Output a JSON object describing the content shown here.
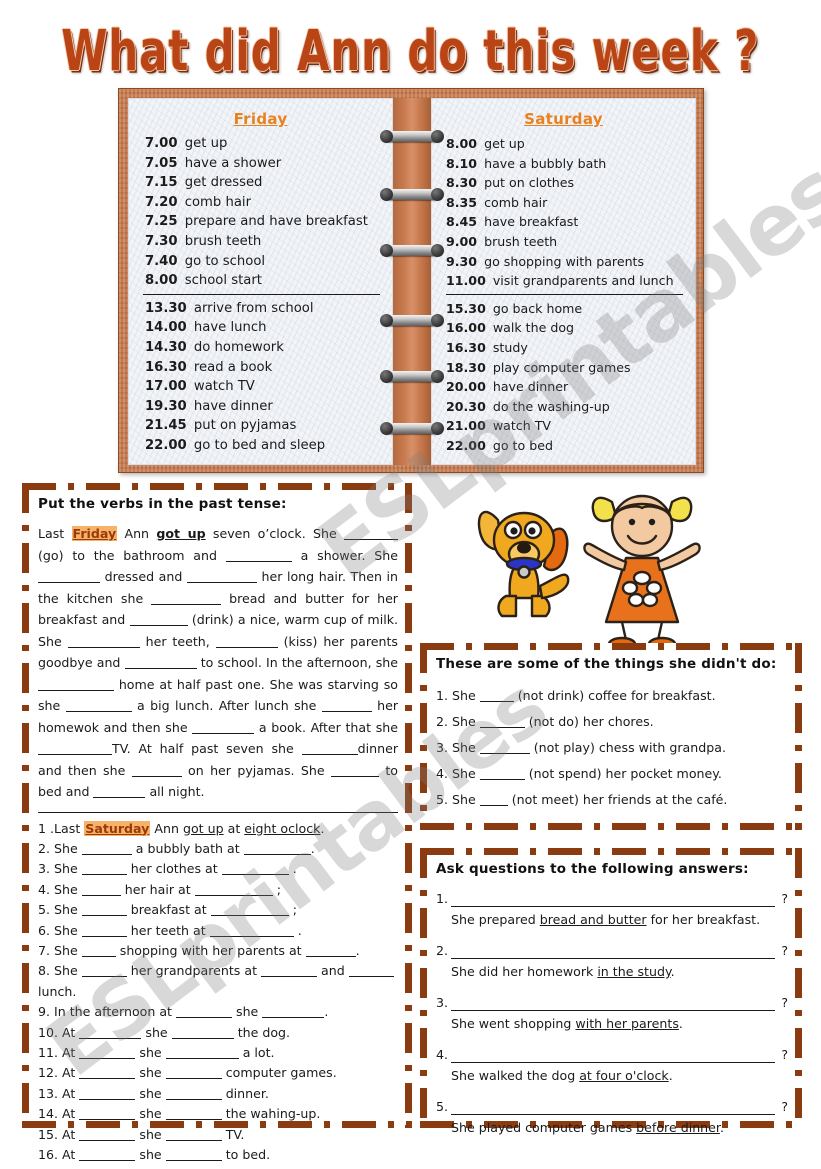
{
  "title": "What did Ann do this week ?",
  "notebook": {
    "friday": {
      "heading": "Friday",
      "morning": [
        {
          "time": "7.00",
          "activity": "get up"
        },
        {
          "time": "7.05",
          "activity": "have a shower"
        },
        {
          "time": "7.15",
          "activity": "get dressed"
        },
        {
          "time": "7.20",
          "activity": "comb hair"
        },
        {
          "time": "7.25",
          "activity": "prepare and have breakfast"
        },
        {
          "time": "7.30",
          "activity": "brush teeth"
        },
        {
          "time": "7.40",
          "activity": "go to school"
        },
        {
          "time": "8.00",
          "activity": "school start"
        }
      ],
      "afternoon": [
        {
          "time": "13.30",
          "activity": "arrive from school"
        },
        {
          "time": "14.00",
          "activity": "have lunch"
        },
        {
          "time": "14.30",
          "activity": "do homework"
        },
        {
          "time": "16.30",
          "activity": "read a book"
        },
        {
          "time": "17.00",
          "activity": "watch TV"
        },
        {
          "time": "19.30",
          "activity": "have dinner"
        },
        {
          "time": "21.45",
          "activity": "put on pyjamas"
        },
        {
          "time": "22.00",
          "activity": "go to bed and sleep"
        }
      ]
    },
    "saturday": {
      "heading": "Saturday",
      "morning": [
        {
          "time": "8.00",
          "activity": "get up"
        },
        {
          "time": "8.10",
          "activity": "have a bubbly bath"
        },
        {
          "time": "8.30",
          "activity": "put on clothes"
        },
        {
          "time": "8.35",
          "activity": "comb hair"
        },
        {
          "time": "8.45",
          "activity": "have breakfast"
        },
        {
          "time": "9.00",
          "activity": "brush teeth"
        },
        {
          "time": "9.30",
          "activity": "go shopping with parents"
        },
        {
          "time": "11.00",
          "activity": "visit grandparents and lunch"
        }
      ],
      "afternoon": [
        {
          "time": "15.30",
          "activity": "go back home"
        },
        {
          "time": "16.00",
          "activity": "walk the dog"
        },
        {
          "time": "16.30",
          "activity": "study"
        },
        {
          "time": "18.30",
          "activity": "play computer games"
        },
        {
          "time": "20.00",
          "activity": "have dinner"
        },
        {
          "time": "20.30",
          "activity": "do the washing-up"
        },
        {
          "time": "21.00",
          "activity": "watch TV"
        },
        {
          "time": "22.00",
          "activity": "go to bed"
        }
      ]
    }
  },
  "exercise1": {
    "heading": "Put the verbs in the past tense:",
    "paragraph_plain": "Last Friday Ann got up seven o'clock. She ______ (go) to the bathroom and ________ a shower. She _______ dressed and _________ her long hair. Then in the kitchen she _________ bread and butter for her breakfast and _______ (drink) a nice, warm cup of milk. She _________ her teeth, ________ (kiss) her parents goodbye and __________ to school. In the afternoon, she __________ home at half past one. She was starving so she ________ a big lunch. After lunch she ______ her homewok and then she ________ a book. After that she __________ TV. At half past seven she ________ dinner and then she ______ on her pyjamas. She ______ to bed and ______ all night.",
    "highlight_word": "Friday",
    "bold_underline": "got up",
    "hints": [
      "(go)",
      "(drink)",
      "(kiss)"
    ]
  },
  "exercise2": {
    "items": [
      "1 .Last Saturday Ann got up at eight oclock.",
      "2. She _________ a bubbly bath at ____________.",
      "3. She ________ her clothes at ____________ .",
      "4. She _______ her hair at ______________ ;",
      "5. She ________ breakfast at ______________ ;",
      "6. She ________ her teeth at _______________ .",
      "7. She ______ shopping with her parents at _________.",
      "8. She ________ her grandparents at __________ and ________ lunch.",
      "9. In the afternoon at __________ she ___________.",
      "10. At ___________ she ___________ the dog.",
      "11. At __________ she _____________ a lot.",
      "12. At __________ she __________ computer games.",
      "13. At __________ she __________ dinner.",
      "14. At __________ she __________ the wahing-up.",
      "15. At __________ she __________ TV.",
      "16. At __________ she __________ to bed."
    ],
    "highlight_word": "Saturday",
    "underlined": [
      "got up",
      "eight oclock"
    ]
  },
  "exercise3": {
    "heading": "These are some of the things she didn't do:",
    "items": [
      "1. She ______ (not  drink) coffee for breakfast.",
      "2. She ________ (not do) her chores.",
      "3. She _________ (not play) chess with grandpa.",
      "4. She ________ (not spend) her pocket money.",
      "5. She _____ (not meet) her friends at the café."
    ]
  },
  "exercise4": {
    "heading": "Ask questions to the following answers:",
    "question_mark": "?",
    "items": [
      {
        "num": "1.",
        "answer_pre": "She prepared ",
        "answer_key": "bread and butter",
        "answer_post": " for her breakfast."
      },
      {
        "num": "2.",
        "answer_pre": " She did her homework ",
        "answer_key": "in the study",
        "answer_post": "."
      },
      {
        "num": "3.",
        "answer_pre": "She went shopping ",
        "answer_key": "with her parents",
        "answer_post": "."
      },
      {
        "num": "4.",
        "answer_pre": "She walked the dog ",
        "answer_key": "at four o'clock",
        "answer_post": "."
      },
      {
        "num": "5.",
        "answer_pre": "She played computer games ",
        "answer_key": "before dinner",
        "answer_post": "."
      }
    ]
  },
  "watermark": {
    "text": "ESLprintables.com",
    "text2": "ESLprintables"
  },
  "colors": {
    "title": "#B94416",
    "book_cover": "#C97B4E",
    "day_heading": "#E8821E",
    "dashed_border": "#8A3C10",
    "highlight_bg": "#F6B26B",
    "dog_body": "#F0A81E",
    "dog_collar": "#2A35C8",
    "girl_dress": "#E8721C",
    "girl_hair": "#F2E14A",
    "girl_skin": "#F2C9A0"
  },
  "clipart": {
    "dog": "cartoon-dog",
    "girl": "cartoon-girl"
  }
}
